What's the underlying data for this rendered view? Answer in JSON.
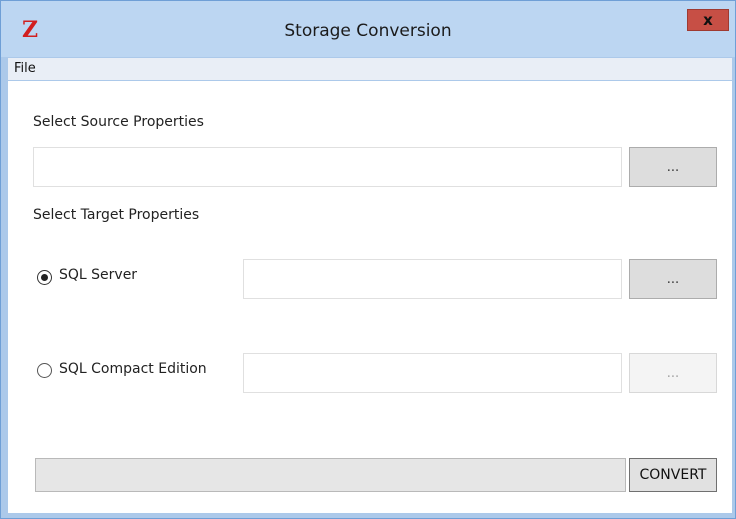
{
  "window": {
    "title": "Storage Conversion",
    "logo": "Z",
    "close_label": "x"
  },
  "menu": {
    "items": [
      {
        "label": "File"
      }
    ]
  },
  "source": {
    "section_label": "Select Source Properties",
    "path_value": "",
    "browse_label": "..."
  },
  "target": {
    "section_label": "Select Target Properties",
    "options": [
      {
        "label": "SQL Server",
        "selected": true,
        "path_value": "",
        "browse_label": "...",
        "enabled": true
      },
      {
        "label": "SQL Compact Edition",
        "selected": false,
        "path_value": "",
        "browse_label": "...",
        "enabled": false
      }
    ]
  },
  "progress": {
    "value": 0
  },
  "actions": {
    "convert_label": "CONVERT"
  },
  "colors": {
    "logo": "#d11f1f",
    "close_button": "#c74f45",
    "title_bar": "#bcd6f2"
  },
  "icons": {
    "app_logo": "z-logo-icon",
    "close": "close-icon"
  }
}
